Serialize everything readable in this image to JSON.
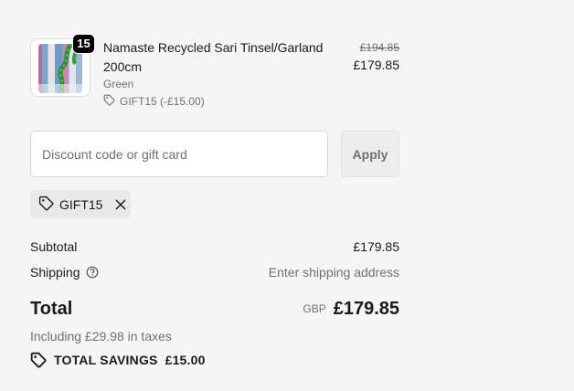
{
  "item": {
    "quantity": "15",
    "title": "Namaste Recycled Sari Tinsel/Garland 200cm",
    "variant": "Green",
    "discount_line": "GIFT15 (-£15.00)",
    "price_original": "£194.85",
    "price_current": "£179.85",
    "thumbnail_icon": "garland-product-image"
  },
  "discount": {
    "placeholder": "Discount code or gift card",
    "value": "",
    "apply_label": "Apply",
    "applied_code": "GIFT15"
  },
  "summary": {
    "subtotal_label": "Subtotal",
    "subtotal_value": "£179.85",
    "shipping_label": "Shipping",
    "shipping_value": "Enter shipping address",
    "total_label": "Total",
    "currency": "GBP",
    "total_value": "£179.85",
    "taxes_note": "Including £29.98 in taxes",
    "savings_label": "TOTAL SAVINGS",
    "savings_value": "£15.00"
  },
  "colors": {
    "background": "#f5f5f5",
    "text": "#1a1a1a",
    "muted": "#707070",
    "badge": "#000000"
  }
}
